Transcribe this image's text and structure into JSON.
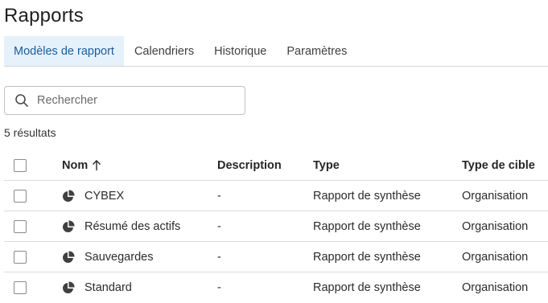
{
  "page": {
    "title": "Rapports"
  },
  "tabs": [
    {
      "label": "Modèles de rapport",
      "active": true
    },
    {
      "label": "Calendriers",
      "active": false
    },
    {
      "label": "Historique",
      "active": false
    },
    {
      "label": "Paramètres",
      "active": false
    }
  ],
  "search": {
    "placeholder": "Rechercher",
    "value": "",
    "icon": "search-icon"
  },
  "results": {
    "count_text": "5 résultats"
  },
  "table": {
    "columns": {
      "name": "Nom",
      "description": "Description",
      "type": "Type",
      "target_type": "Type de cible"
    },
    "sort_icon": "arrow-up-icon",
    "row_icon": "pie-chart-icon",
    "rows": [
      {
        "name": "CYBEX",
        "description": "-",
        "type": "Rapport de synthèse",
        "target_type": "Organisation"
      },
      {
        "name": "Résumé des actifs",
        "description": "-",
        "type": "Rapport de synthèse",
        "target_type": "Organisation"
      },
      {
        "name": "Sauvegardes",
        "description": "-",
        "type": "Rapport de synthèse",
        "target_type": "Organisation"
      },
      {
        "name": "Standard",
        "description": "-",
        "type": "Rapport de synthèse",
        "target_type": "Organisation"
      }
    ]
  },
  "colors": {
    "active_tab_bg": "#e5f1fb",
    "active_tab_text": "#1d5d9a"
  }
}
